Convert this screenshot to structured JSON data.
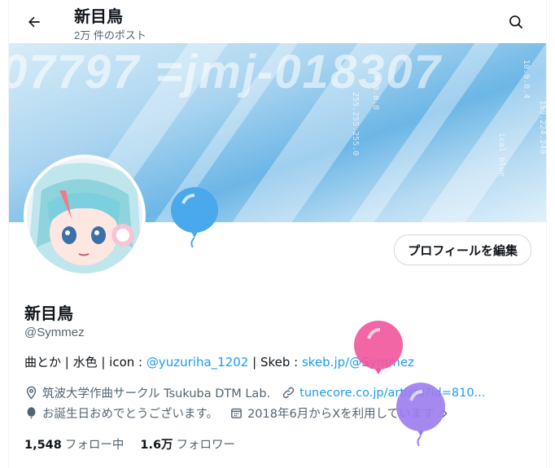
{
  "header": {
    "title": "新目鳥",
    "post_count": "2万 件のポスト"
  },
  "profile": {
    "edit_button": "プロフィールを編集",
    "name": "新目鳥",
    "handle": "@Symmez",
    "bio": {
      "prefix": "曲とか | 水色 | icon : ",
      "mention": "@yuzuriha_1202",
      "mid": " | Skeb : ",
      "skeb_link": "skeb.jp/@Symmez"
    },
    "location": "筑波大学作曲サークル Tsukuba DTM Lab.",
    "website": "tunecore.co.jp/artists?id=810...",
    "birthday": "お誕生日おめでとうございます。",
    "joined": "2018年6月からXを利用しています"
  },
  "stats": {
    "following_count": "1,548",
    "following_label": "フォロー中",
    "followers_count": "1.6万",
    "followers_label": "フォロワー"
  },
  "colors": {
    "accent": "#1d9bf0",
    "balloon_blue": "#4aa8ec",
    "balloon_pink": "#f2559b",
    "balloon_purple": "#9b7cf0"
  }
}
